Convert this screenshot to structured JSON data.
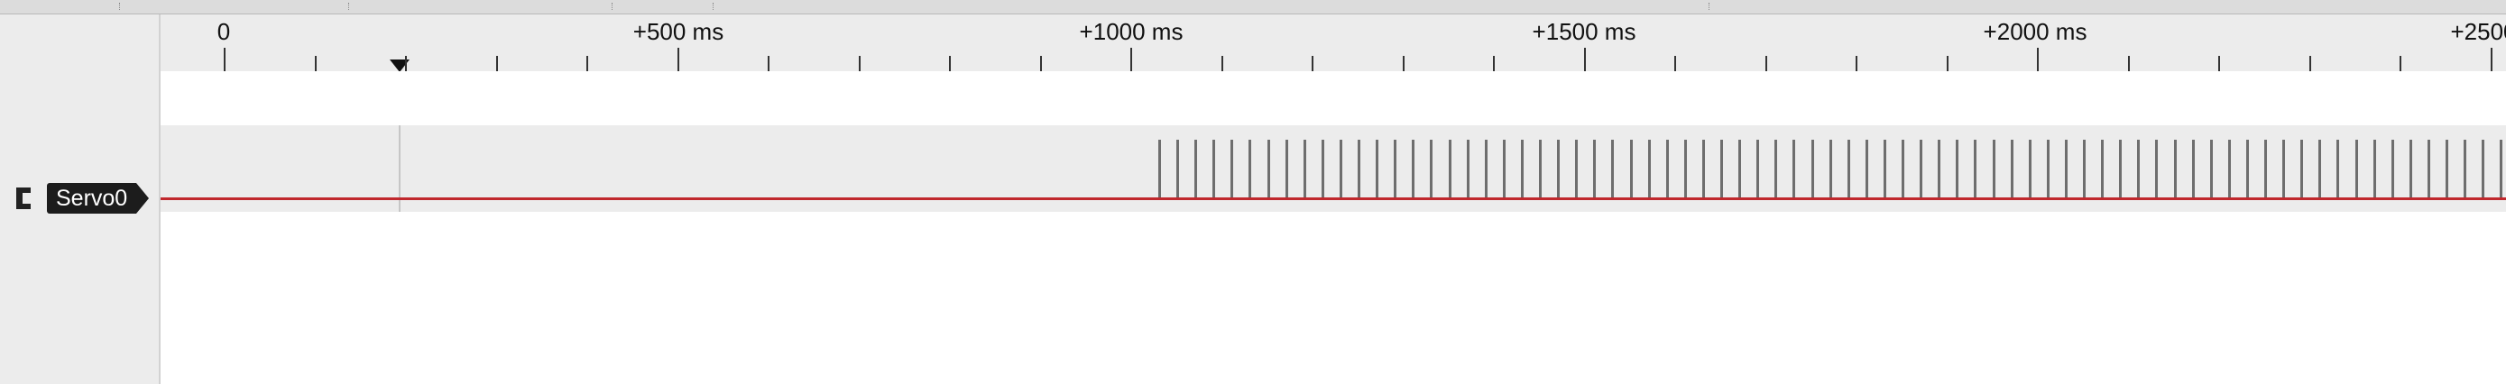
{
  "timeline": {
    "ticks": [
      "0",
      "+500 ms",
      "+1000 ms",
      "+1500 ms",
      "+2000 ms",
      "+2500"
    ]
  },
  "channel": {
    "name": "Servo0",
    "icon": "channel-connector-icon",
    "signal_color": "#c0282d"
  },
  "colors": {
    "background": "#ececec",
    "pulse": "#6e6e6e",
    "label_bg": "#1c1c1c"
  }
}
